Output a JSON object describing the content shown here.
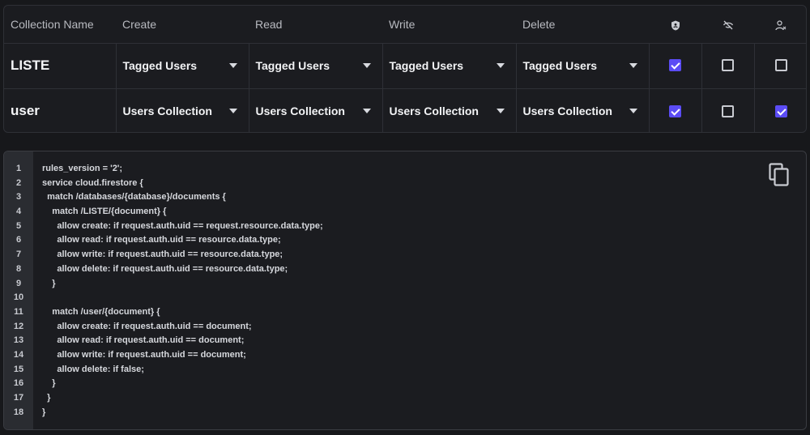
{
  "table": {
    "headers": {
      "collection_name": "Collection Name",
      "create": "Create",
      "read": "Read",
      "write": "Write",
      "delete": "Delete"
    },
    "header_icons": [
      "shield-icon",
      "eye-off-icon",
      "user-x-icon"
    ],
    "rows": [
      {
        "name": "LISTE",
        "create": "Tagged Users",
        "read": "Tagged Users",
        "write": "Tagged Users",
        "delete": "Tagged Users",
        "flags": [
          true,
          false,
          false
        ]
      },
      {
        "name": "user",
        "create": "Users Collection",
        "read": "Users Collection",
        "write": "Users Collection",
        "delete": "Users Collection",
        "flags": [
          true,
          false,
          true
        ]
      }
    ]
  },
  "code": {
    "lines": [
      "rules_version = '2';",
      "service cloud.firestore {",
      "  match /databases/{database}/documents {",
      "    match /LISTE/{document} {",
      "      allow create: if request.auth.uid == request.resource.data.type;",
      "      allow read: if request.auth.uid == resource.data.type;",
      "      allow write: if request.auth.uid == resource.data.type;",
      "      allow delete: if request.auth.uid == resource.data.type;",
      "    }",
      "",
      "    match /user/{document} {",
      "      allow create: if request.auth.uid == document;",
      "      allow read: if request.auth.uid == document;",
      "      allow write: if request.auth.uid == document;",
      "      allow delete: if false;",
      "    }",
      "  }",
      "}"
    ],
    "line_numbers": [
      "1",
      "2",
      "3",
      "4",
      "5",
      "6",
      "7",
      "8",
      "9",
      "10",
      "11",
      "12",
      "13",
      "14",
      "15",
      "16",
      "17",
      "18"
    ],
    "copy_icon": "copy-icon"
  },
  "colors": {
    "accent": "#5b4cf5",
    "background": "#17181b",
    "border": "#2e3036"
  }
}
